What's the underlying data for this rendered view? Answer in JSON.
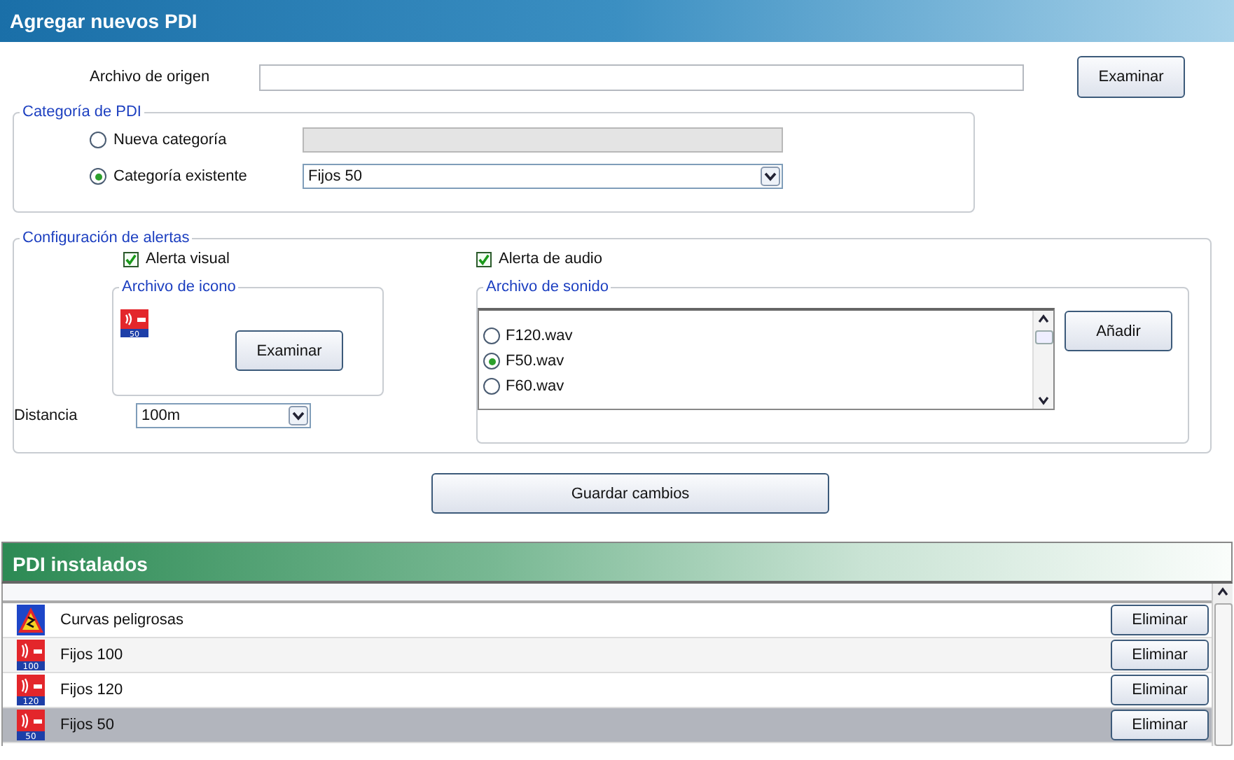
{
  "header": {
    "title": "Agregar nuevos PDI"
  },
  "source": {
    "label": "Archivo de origen",
    "button": "Examinar"
  },
  "category": {
    "legend": "Categoría de PDI",
    "options": [
      {
        "label": "Nueva categoría",
        "selected": false,
        "field": {
          "kind": "text",
          "disabled": true
        }
      },
      {
        "label": "Categoría existente",
        "selected": true,
        "field": {
          "kind": "select",
          "value": "Fijos 50",
          "disabled": false
        }
      }
    ]
  },
  "alerts": {
    "legend": "Configuración de alertas",
    "visual": {
      "label": "Alerta visual",
      "checked": true
    },
    "audio": {
      "label": "Alerta de audio",
      "checked": true
    },
    "icon_file": {
      "legend": "Archivo de icono",
      "icon_label": "50",
      "button": "Examinar"
    },
    "sound_file": {
      "legend": "Archivo de sonido",
      "button": "Añadir",
      "items": [
        {
          "label": "F120.wav",
          "selected": false
        },
        {
          "label": "F50.wav",
          "selected": true
        },
        {
          "label": "F60.wav",
          "selected": false
        }
      ]
    },
    "distance": {
      "label": "Distancia",
      "value": "100m"
    }
  },
  "save_button": "Guardar cambios",
  "installed": {
    "title": "PDI instalados",
    "rows": [
      {
        "kind": "warning",
        "name": "Curvas peligrosas",
        "button": "Eliminar",
        "selected": false
      },
      {
        "kind": "speed",
        "icon_label": "100",
        "name": "Fijos 100",
        "button": "Eliminar",
        "selected": false
      },
      {
        "kind": "speed",
        "icon_label": "120",
        "name": "Fijos 120",
        "button": "Eliminar",
        "selected": false
      },
      {
        "kind": "speed",
        "icon_label": "50",
        "name": "Fijos 50",
        "button": "Eliminar",
        "selected": true
      }
    ]
  }
}
